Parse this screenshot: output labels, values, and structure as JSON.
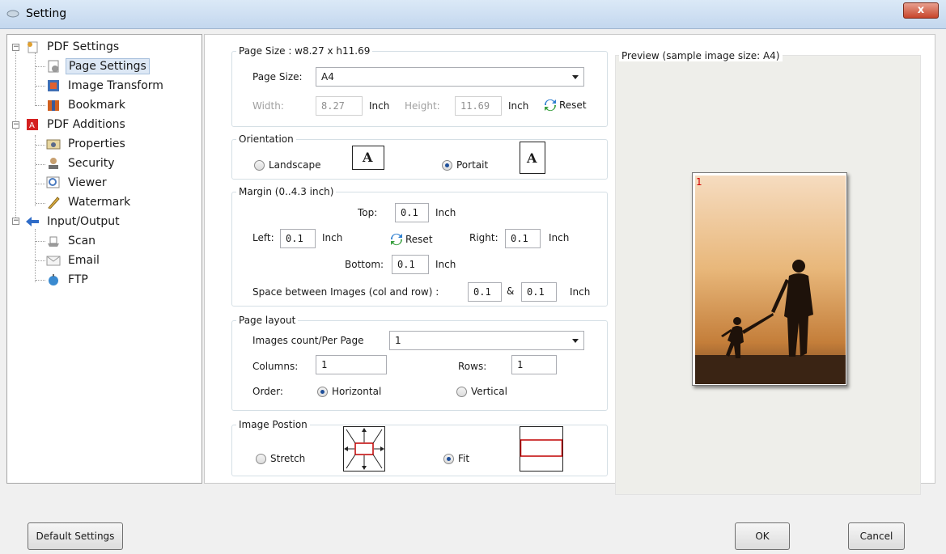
{
  "window": {
    "title": "Setting",
    "close_glyph": "x"
  },
  "tree": {
    "items": [
      {
        "label": "PDF Settings",
        "icon": "pdf-settings-icon"
      },
      {
        "label": "Page Settings",
        "icon": "page-settings-icon",
        "selected": true
      },
      {
        "label": "Image Transform",
        "icon": "image-transform-icon"
      },
      {
        "label": "Bookmark",
        "icon": "bookmark-icon"
      },
      {
        "label": "PDF Additions",
        "icon": "pdf-additions-icon"
      },
      {
        "label": "Properties",
        "icon": "properties-icon"
      },
      {
        "label": "Security",
        "icon": "security-icon"
      },
      {
        "label": "Viewer",
        "icon": "viewer-icon"
      },
      {
        "label": "Watermark",
        "icon": "watermark-icon"
      },
      {
        "label": "Input/Output",
        "icon": "input-output-icon"
      },
      {
        "label": "Scan",
        "icon": "scan-icon"
      },
      {
        "label": "Email",
        "icon": "email-icon"
      },
      {
        "label": "FTP",
        "icon": "ftp-icon"
      }
    ],
    "expander": "−"
  },
  "page_size": {
    "group_label": "Page Size : w8.27 x h11.69",
    "label": "Page Size:",
    "value": "A4",
    "width_label": "Width:",
    "width_value": "8.27",
    "height_label": "Height:",
    "height_value": "11.69",
    "unit": "Inch",
    "reset_label": "Reset"
  },
  "orientation": {
    "group_label": "Orientation",
    "landscape_label": "Landscape",
    "portrait_label": "Portait",
    "selected": "portrait",
    "glyph": "A"
  },
  "margin": {
    "group_label": "Margin (0..4.3 inch)",
    "top_label": "Top:",
    "top_value": "0.1",
    "left_label": "Left:",
    "left_value": "0.1",
    "right_label": "Right:",
    "right_value": "0.1",
    "bottom_label": "Bottom:",
    "bottom_value": "0.1",
    "unit": "Inch",
    "reset_label": "Reset",
    "space_label": "Space between Images (col and row) :",
    "space_col": "0.1",
    "space_amp": "&",
    "space_row": "0.1"
  },
  "layout": {
    "group_label": "Page layout",
    "count_label": "Images count/Per Page",
    "count_value": "1",
    "columns_label": "Columns:",
    "columns_value": "1",
    "rows_label": "Rows:",
    "rows_value": "1",
    "order_label": "Order:",
    "horizontal_label": "Horizontal",
    "vertical_label": "Vertical",
    "selected": "horizontal"
  },
  "position": {
    "group_label": "Image Postion",
    "stretch_label": "Stretch",
    "fit_label": "Fit",
    "selected": "fit"
  },
  "preview": {
    "label": "Preview (sample image size: A4)",
    "page_number": "1"
  },
  "footer": {
    "default_label": "Default Settings",
    "ok_label": "OK",
    "cancel_label": "Cancel"
  },
  "colors": {
    "accent": "#1f4f9a",
    "fit_rect": "#c00000",
    "page_number": "#d40000"
  }
}
